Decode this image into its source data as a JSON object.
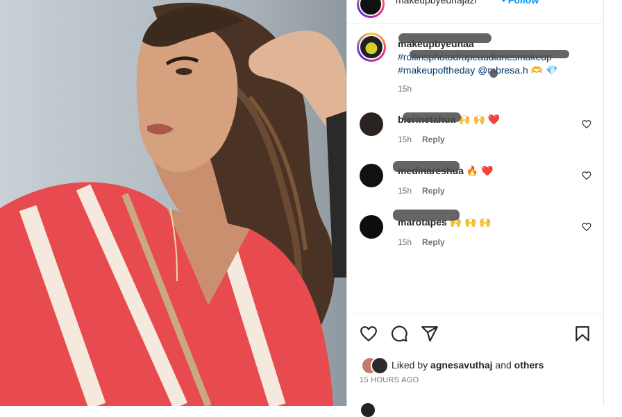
{
  "post_header": {
    "username": "makeupbyeunajazi",
    "follow_label": "Follow",
    "more_icon": "more-icon"
  },
  "caption": {
    "username": "makeupbyeunaa",
    "hashtags": "#rollinsphotodrapeaudiariesmakeup #makeupoftheday",
    "mention": "@mbresa.h",
    "emoji": "🫶 💎",
    "time": "15h"
  },
  "comments": [
    {
      "username": "blerinetahua",
      "text": "🙌 🙌 ❤️",
      "time": "15h",
      "reply": "Reply"
    },
    {
      "username": "medinareshua",
      "text": "🔥 ❤️",
      "time": "15h",
      "reply": "Reply"
    },
    {
      "username": "marotapes",
      "text": "🙌 🙌 🙌",
      "time": "15h",
      "reply": "Reply"
    }
  ],
  "likes": {
    "prefix": "Liked by ",
    "user": "agnesavuthaj",
    "middle": " and ",
    "others": "others"
  },
  "timestamp": "15 HOURS AGO",
  "icons": [
    "heart-icon",
    "comment-icon",
    "share-icon",
    "bookmark-icon"
  ],
  "colors": {
    "accent": "#0095f6",
    "text": "#262626",
    "muted": "#737373",
    "heart_red": "#ed4956"
  }
}
